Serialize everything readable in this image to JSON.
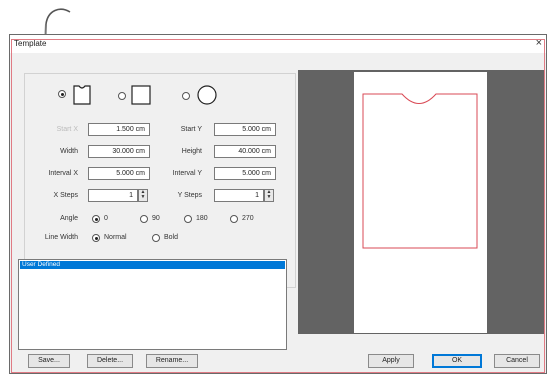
{
  "window": {
    "title": "Template",
    "close_glyph": "×"
  },
  "shapes": [
    {
      "icon": "rectangle-notch-shape-icon",
      "selected": true
    },
    {
      "icon": "square-shape-icon",
      "selected": false
    },
    {
      "icon": "circle-shape-icon",
      "selected": false
    }
  ],
  "fields": {
    "start_x_label": "Start X",
    "start_x": "1.500 cm",
    "start_y_label": "Start Y",
    "start_y": "5.000 cm",
    "width_label": "Width",
    "width": "30.000 cm",
    "height_label": "Height",
    "height": "40.000 cm",
    "interval_x_label": "Interval X",
    "interval_x": "5.000 cm",
    "interval_y_label": "Interval Y",
    "interval_y": "5.000 cm",
    "x_steps_label": "X Steps",
    "x_steps": "1",
    "y_steps_label": "Y Steps",
    "y_steps": "1"
  },
  "angle": {
    "label": "Angle",
    "options": [
      "0",
      "90",
      "180",
      "270"
    ],
    "selected": "0"
  },
  "line_width": {
    "label": "Line Width",
    "options": [
      "Normal",
      "Bold"
    ],
    "selected": "Normal"
  },
  "list": {
    "items": [
      "User Defined"
    ],
    "selected": "User Defined"
  },
  "buttons": {
    "save": "Save...",
    "delete": "Delete...",
    "rename": "Rename...",
    "apply": "Apply",
    "ok": "OK",
    "cancel": "Cancel"
  },
  "colors": {
    "accent": "#0078d7",
    "outline_red": "#d94a55",
    "preview_bg": "#636363"
  }
}
